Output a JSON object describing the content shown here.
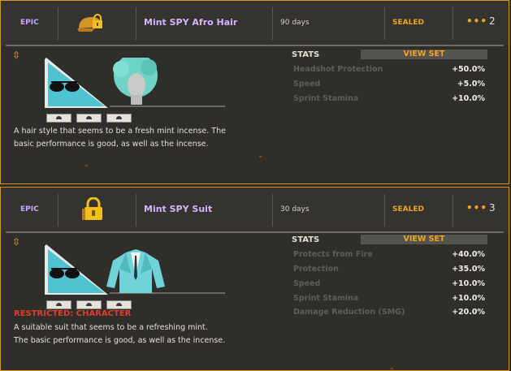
{
  "items": [
    {
      "grade": "EPIC",
      "name": "Mint SPY Afro Hair",
      "duration": "90 days",
      "status": "SEALED",
      "count": "2",
      "stats_label": "STATS",
      "view_set": "VIEW SET",
      "stats": [
        {
          "name": "Headshot Protection",
          "value": "+50.0%"
        },
        {
          "name": "Speed",
          "value": "+5.0%"
        },
        {
          "name": "Sprint Stamina",
          "value": "+10.0%"
        }
      ],
      "restriction": "",
      "description": [
        "A hair style that seems to be a fresh mint incense. The",
        "basic performance is good, as well as the incense."
      ]
    },
    {
      "grade": "EPIC",
      "name": "Mint SPY Suit",
      "duration": "30 days",
      "status": "SEALED",
      "count": "3",
      "stats_label": "STATS",
      "view_set": "VIEW SET",
      "stats": [
        {
          "name": "Protects from Fire",
          "value": "+40.0%"
        },
        {
          "name": "Protection",
          "value": "+35.0%"
        },
        {
          "name": "Speed",
          "value": "+10.0%"
        },
        {
          "name": "Sprint Stamina",
          "value": "+10.0%"
        },
        {
          "name": "Damage Reduction (SMG)",
          "value": "+20.0%"
        }
      ],
      "restriction": "RESTRICTED: CHARACTER",
      "description": [
        "A suitable suit that seems to be a refreshing mint.",
        "The basic performance is good, as well as the incense."
      ]
    }
  ],
  "colors": {
    "accent": "#f0a51f",
    "grade_epic": "#c9a8ff",
    "restricted": "#e33b2c",
    "border": "#d9951e"
  },
  "icons": {
    "header_item_1": "cap-lock-icon",
    "header_item_2": "lock-icon",
    "dots": "more-options-icon",
    "compare": "up-down-arrow-icon"
  }
}
